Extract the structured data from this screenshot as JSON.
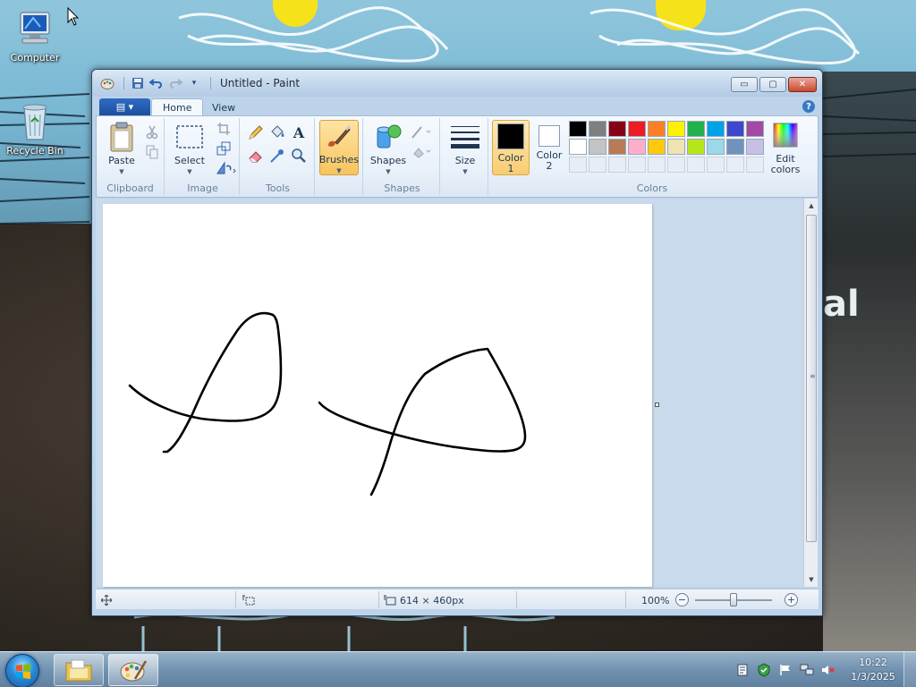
{
  "desktop": {
    "icons": [
      {
        "label": "Computer"
      },
      {
        "label": "Recycle Bin"
      }
    ],
    "wallpaper_text": "al"
  },
  "window": {
    "title": "Untitled - Paint",
    "controls": {
      "minimize": "▭",
      "maximize": "▢",
      "close": "✕"
    }
  },
  "ribbon": {
    "file_tab_icon": "▤ ▾",
    "tabs": [
      {
        "label": "Home",
        "active": true
      },
      {
        "label": "View",
        "active": false
      }
    ],
    "help": "?",
    "groups": {
      "clipboard": {
        "label": "Clipboard",
        "paste": "Paste"
      },
      "image": {
        "label": "Image",
        "select": "Select"
      },
      "tools": {
        "label": "Tools"
      },
      "brushes": {
        "label": "Brushes"
      },
      "shapes": {
        "label": "Shapes",
        "shapes": "Shapes"
      },
      "size": {
        "label": "Size"
      },
      "colors": {
        "label": "Colors",
        "color1": "Color 1",
        "color1_value": "#000000",
        "color2": "Color 2",
        "color2_value": "#ffffff",
        "edit_colors": "Edit colors",
        "palette_row1": [
          "#000000",
          "#7f7f7f",
          "#880015",
          "#ed1c24",
          "#ff7f27",
          "#fff200",
          "#22b14c",
          "#00a2e8",
          "#3f48cc",
          "#a349a4"
        ],
        "palette_row2": [
          "#ffffff",
          "#c3c3c3",
          "#b97a57",
          "#ffaec9",
          "#ffc90e",
          "#efe4b0",
          "#b5e61d",
          "#99d9ea",
          "#7092be",
          "#c8bfe7"
        ]
      }
    }
  },
  "statusbar": {
    "selection_size": "",
    "canvas_size": "614 × 460px",
    "zoom": "100%"
  },
  "taskbar": {
    "time": "10:22",
    "date": "1/3/2025"
  },
  "colors": {
    "accent": "#1b4f9c",
    "active_tool": "#f8c45c",
    "stroke": "#000000"
  }
}
